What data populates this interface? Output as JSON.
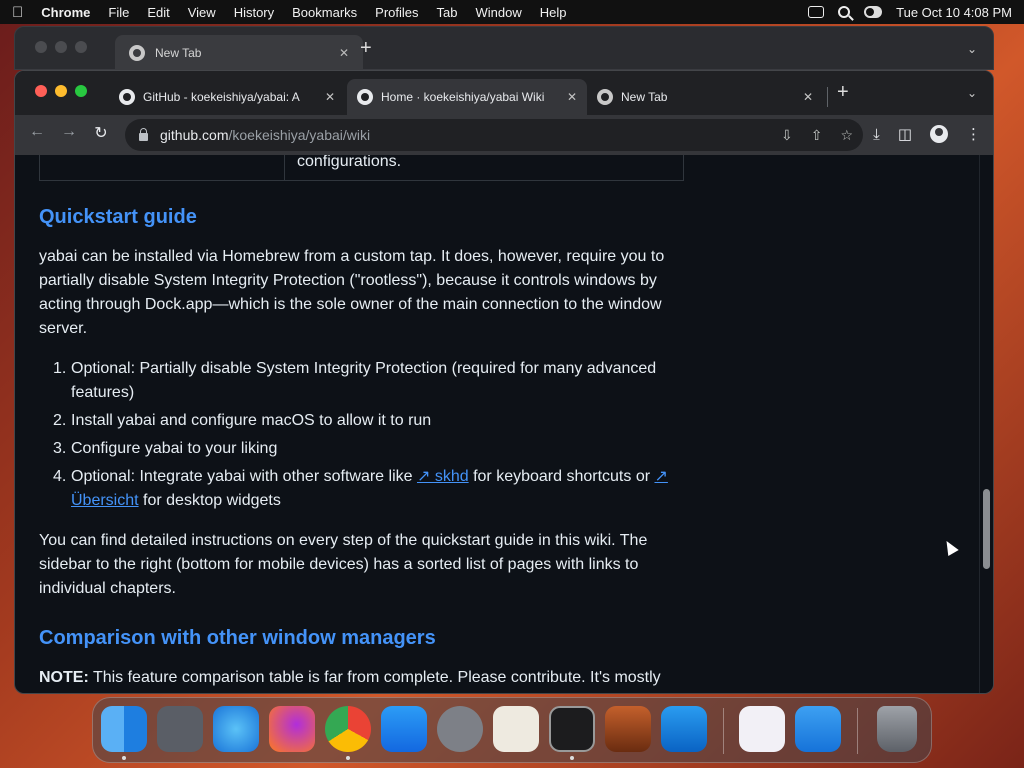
{
  "menubar": {
    "app": "Chrome",
    "items": [
      "File",
      "Edit",
      "View",
      "History",
      "Bookmarks",
      "Profiles",
      "Tab",
      "Window",
      "Help"
    ],
    "clock": "Tue Oct 10  4:08 PM"
  },
  "back_window": {
    "tab_title": "New Tab"
  },
  "tabs": [
    {
      "title": "GitHub - koekeishiya/yabai: A",
      "icon": "github-icon"
    },
    {
      "title": "Home · koekeishiya/yabai Wiki",
      "icon": "github-icon",
      "active": true
    },
    {
      "title": "New Tab",
      "icon": "chrome-icon"
    }
  ],
  "omnibox": {
    "host": "github.com",
    "path": "/koekeishiya/yabai/wiki"
  },
  "page": {
    "table_tail": "configurations.",
    "quickstart_heading": "Quickstart guide",
    "quickstart_para": "yabai can be installed via Homebrew from a custom tap. It does, however, require you to partially disable System Integrity Protection (\"rootless\"), because it controls windows by acting through Dock.app—which is the sole owner of the main connection to the window server.",
    "steps": [
      "Optional: Partially disable System Integrity Protection (required for many advanced features)",
      "Install yabai and configure macOS to allow it to run",
      "Configure yabai to your liking"
    ],
    "step4": {
      "before": "Optional: Integrate yabai with other software like ",
      "link1": "↗ skhd",
      "middle": " for keyboard shortcuts or ",
      "link2": "↗ Übersicht",
      "after": " for desktop widgets"
    },
    "detail_para": "You can find detailed instructions on every step of the quickstart guide in this wiki. The sidebar to the right (bottom for mobile devices) has a sorted list of pages with links to individual chapters.",
    "comparison_heading": "Comparison with other window managers",
    "note_label": "NOTE:",
    "note_text": " This feature comparison table is far from complete. Please contribute. It's mostly"
  },
  "dock": {
    "apps": [
      "finder-icon",
      "launchpad-icon",
      "safari-icon",
      "firefox-icon",
      "chrome-icon",
      "app-store-icon",
      "system-settings-icon",
      "textedit-icon",
      "terminal-icon",
      "garageband-icon",
      "vscode-icon",
      "visual-studio-icon",
      "weather-icon",
      "trash-icon"
    ]
  },
  "colors": {
    "link": "#4493f8",
    "page_bg": "#0d1117",
    "text": "#e6edf3"
  }
}
